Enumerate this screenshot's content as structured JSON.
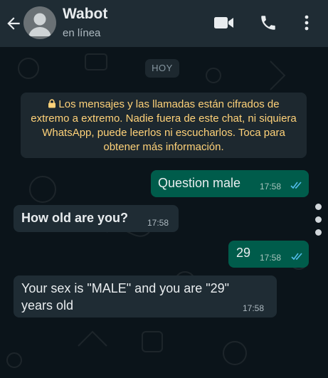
{
  "header": {
    "contact_name": "Wabot",
    "status": "en línea",
    "icons": [
      "back-arrow-icon",
      "avatar-icon",
      "video-call-icon",
      "phone-call-icon",
      "more-options-icon"
    ]
  },
  "chat": {
    "date_chip": "HOY",
    "encryption_notice": "Los mensajes y las llamadas están cifrados de extremo a extremo. Nadie fuera de este chat, ni siquiera WhatsApp, puede leerlos ni escucharlos. Toca para obtener más información.",
    "messages": [
      {
        "direction": "outgoing",
        "text": "Question male",
        "time": "17:58",
        "status": "read"
      },
      {
        "direction": "incoming",
        "text": "How old are you?",
        "time": "17:58"
      },
      {
        "direction": "outgoing",
        "text": "29",
        "time": "17:58",
        "status": "read"
      },
      {
        "direction": "incoming",
        "text_line1": "Your sex is \"MALE\" and you are \"29\"",
        "text_line2": "years old",
        "time": "17:58"
      }
    ]
  },
  "colors": {
    "header_bg": "#1f2c34",
    "chat_bg": "#0b141a",
    "outgoing_bubble": "#005c4b",
    "incoming_bubble": "#1f2c34",
    "notice_text": "#ffd279",
    "read_ticks": "#53bdeb"
  }
}
